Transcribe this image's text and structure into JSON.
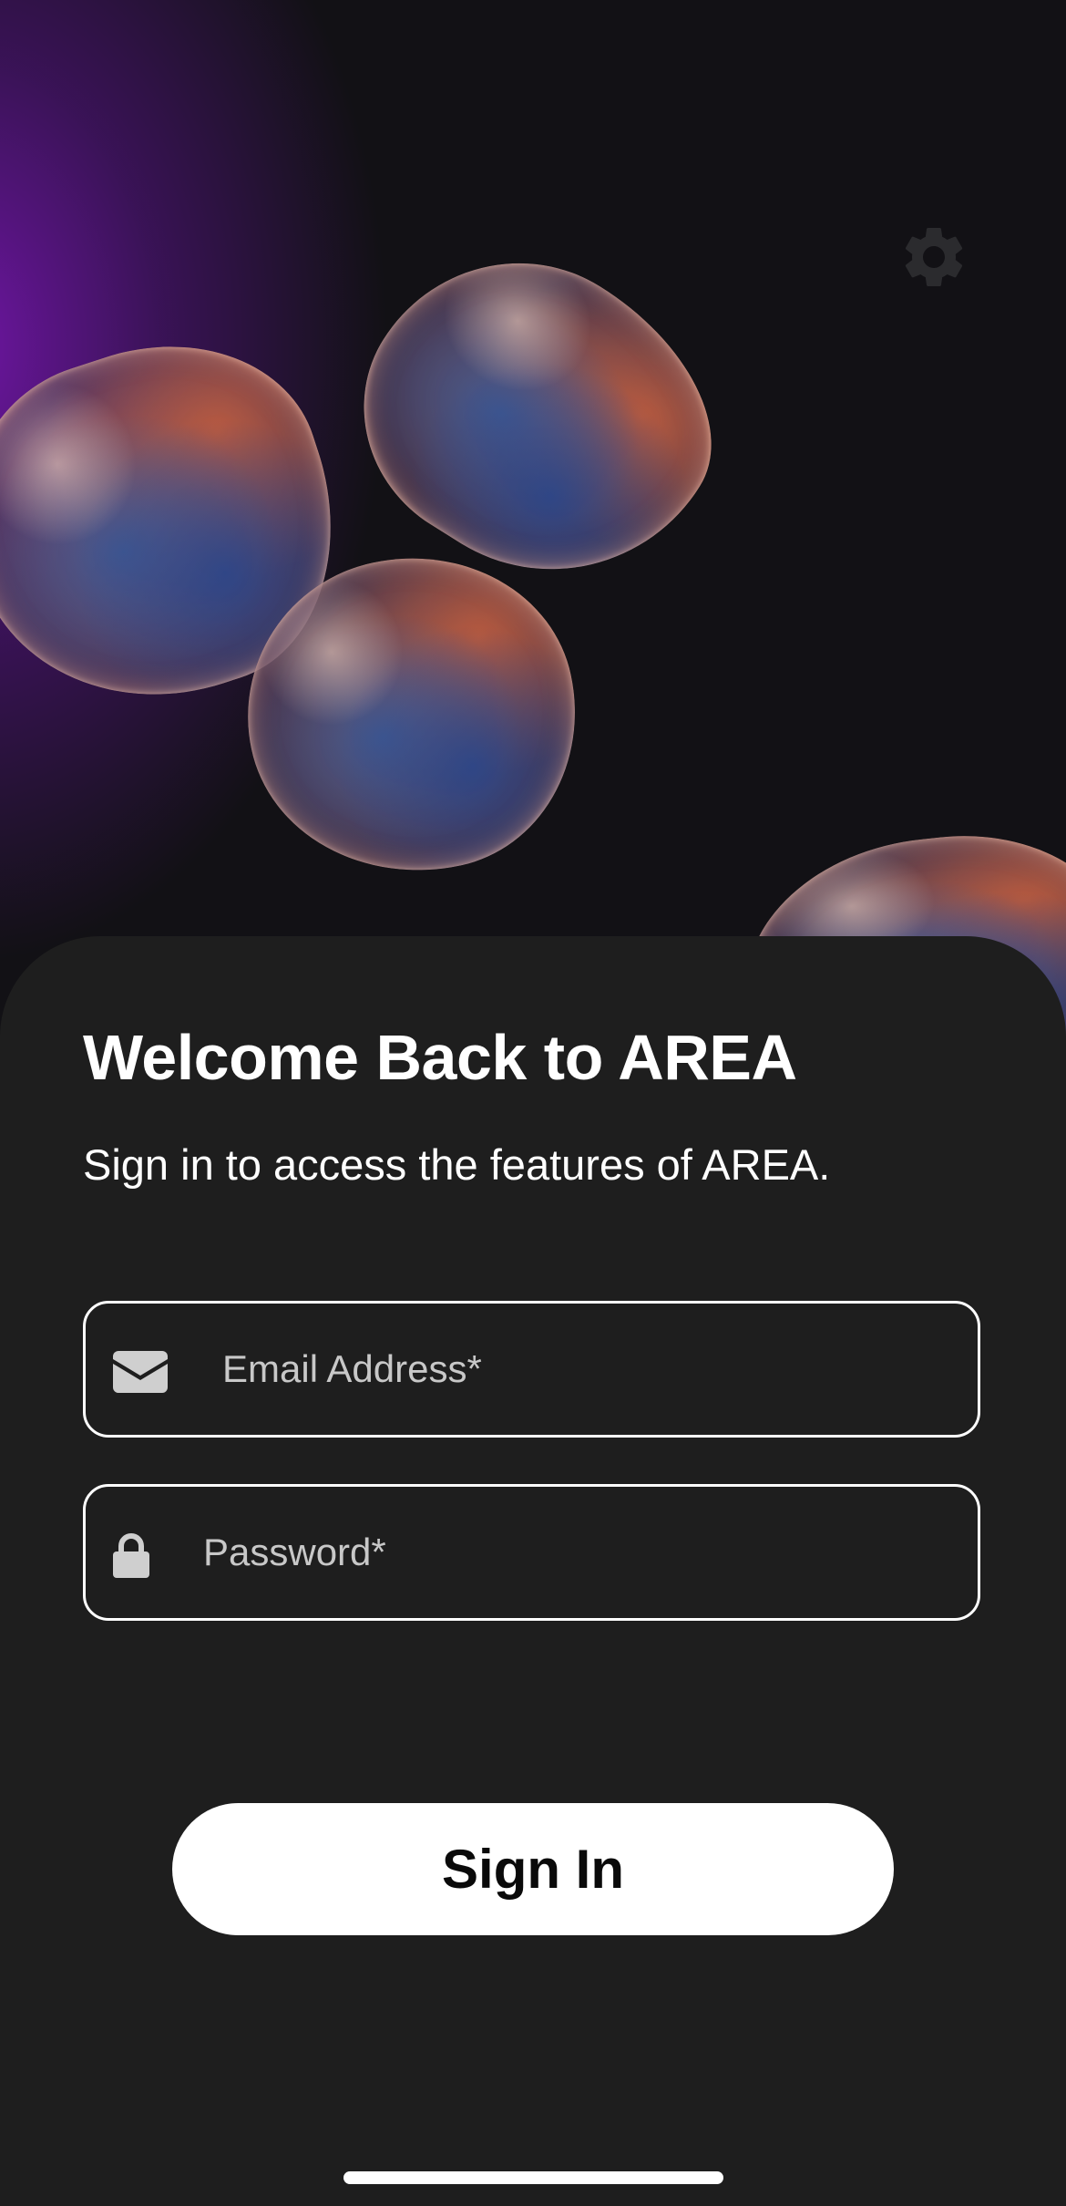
{
  "login": {
    "title": "Welcome Back to AREA",
    "subtitle": "Sign in to access the features of AREA.",
    "email_placeholder": "Email Address*",
    "password_placeholder": "Password*",
    "signin_label": "Sign In"
  },
  "icons": {
    "settings": "gear-icon",
    "email": "envelope-icon",
    "password": "lock-icon"
  },
  "colors": {
    "background": "#121115",
    "accent_purple": "#7316aa",
    "sheet": "#1e1e1e",
    "button": "#ffffff",
    "button_text": "#0a0a0a",
    "placeholder": "#c8c8c8"
  }
}
